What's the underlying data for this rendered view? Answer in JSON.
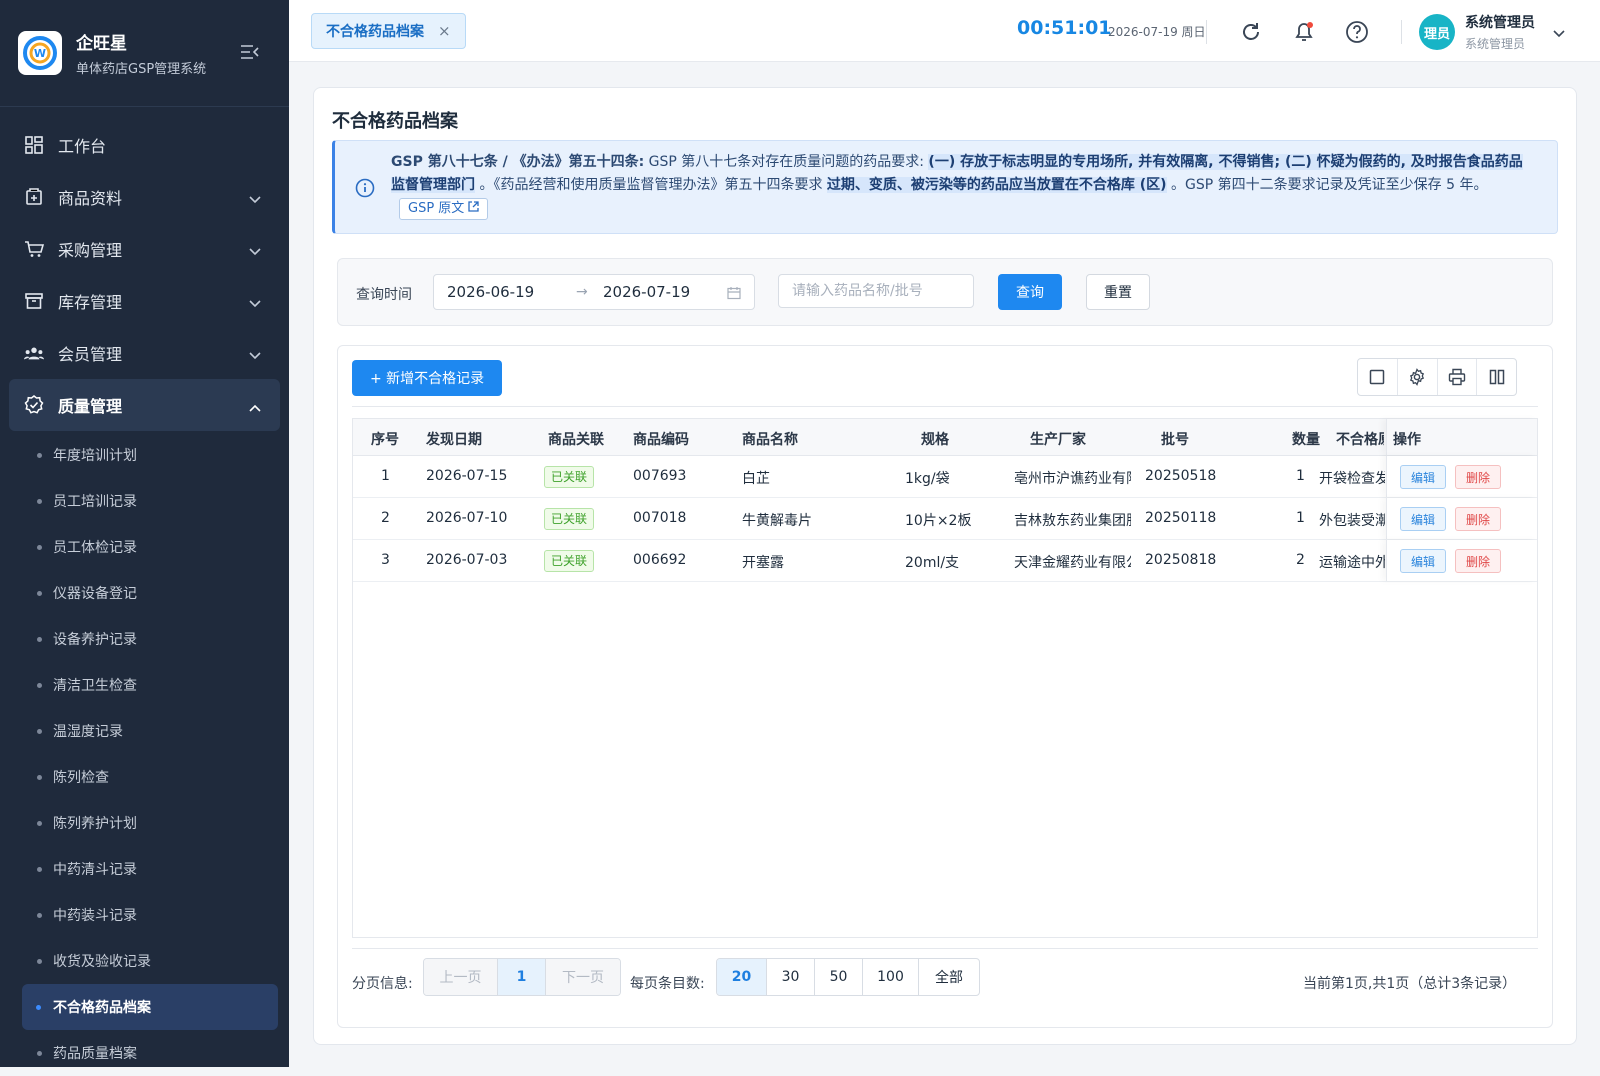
{
  "brand": {
    "name": "企旺星",
    "subtitle": "单体药店GSP管理系统"
  },
  "nav": [
    {
      "label": "工作台",
      "icon": "dashboard-icon",
      "expandable": false
    },
    {
      "label": "商品资料",
      "icon": "product-icon",
      "expandable": true
    },
    {
      "label": "采购管理",
      "icon": "cart-icon",
      "expandable": true
    },
    {
      "label": "库存管理",
      "icon": "inventory-icon",
      "expandable": true
    },
    {
      "label": "会员管理",
      "icon": "members-icon",
      "expandable": true
    },
    {
      "label": "质量管理",
      "icon": "quality-icon",
      "expandable": true,
      "expanded": true
    }
  ],
  "quality_submenu": [
    "年度培训计划",
    "员工培训记录",
    "员工体检记录",
    "仪器设备登记",
    "设备养护记录",
    "清洁卫生检查",
    "温湿度记录",
    "陈列检查",
    "陈列养护计划",
    "中药清斗记录",
    "中药装斗记录",
    "收货及验收记录",
    "不合格药品档案",
    "药品质量档案"
  ],
  "active_submenu": "不合格药品档案",
  "topbar": {
    "tab_label": "不合格药品档案",
    "tab_close": "×",
    "time": "00:51:01",
    "date": "2026-07-19 周日",
    "user_avatar": "理员",
    "user_name": "系统管理员",
    "user_role": "系统管理员",
    "icons": [
      "refresh-icon",
      "bell-icon",
      "help-icon"
    ],
    "has_notification": true
  },
  "page": {
    "title": "不合格药品档案",
    "notice": {
      "lead": "GSP 第八十七条 / 《办法》第五十四条:",
      "t1": " GSP 第八十七条对存在质量问题的药品要求: ",
      "h1": "(一) 存放于标志明显的专用场所, 并有效隔离, 不得销售; (二) 怀疑为假药的, 及时报告食品药品监督管理部门",
      "t2": " 。《药品经营和使用质量监督管理办法》第五十四条要求 ",
      "h2": "过期、变质、被污染等的药品应当放置在不合格库 (区)",
      "t3": " 。GSP 第四十二条要求记录及凭证至少保存 5 年。",
      "link": "GSP 原文"
    },
    "filter": {
      "label": "查询时间",
      "start": "2026-06-19",
      "end": "2026-07-19",
      "arrow": "→",
      "search_placeholder": "请输入药品名称/批号",
      "query": "查询",
      "reset": "重置"
    },
    "add_button": "+ 新增不合格记录",
    "toolbar_icons": [
      "fullscreen-icon",
      "settings-icon",
      "print-icon",
      "columns-icon"
    ],
    "table": {
      "headers": [
        "序号",
        "发现日期",
        "商品关联",
        "商品编码",
        "商品名称",
        "规格",
        "生产厂家",
        "批号",
        "数量",
        "不合格原因",
        "操作"
      ],
      "rows": [
        {
          "no": "1",
          "date": "2026-07-15",
          "linked": "已关联",
          "code": "007693",
          "name": "白芷",
          "spec": "1kg/袋",
          "maker": "亳州市沪谯药业有限公司",
          "batch": "20250518",
          "qty": "1",
          "reason": "开袋检查发现霉变",
          "edit": "编辑",
          "del": "删除"
        },
        {
          "no": "2",
          "date": "2026-07-10",
          "linked": "已关联",
          "code": "007018",
          "name": "牛黄解毒片",
          "spec": "10片×2板",
          "maker": "吉林敖东药业集团股份有限公司",
          "batch": "20250118",
          "qty": "1",
          "reason": "外包装受潮",
          "edit": "编辑",
          "del": "删除"
        },
        {
          "no": "3",
          "date": "2026-07-03",
          "linked": "已关联",
          "code": "006692",
          "name": "开塞露",
          "spec": "20ml/支",
          "maker": "天津金耀药业有限公司",
          "batch": "20250818",
          "qty": "2",
          "reason": "运输途中外包装破损",
          "edit": "编辑",
          "del": "删除"
        }
      ]
    },
    "pager": {
      "label": "分页信息:",
      "prev": "上一页",
      "current": "1",
      "next": "下一页",
      "size_label": "每页条目数:",
      "sizes": [
        "20",
        "30",
        "50",
        "100",
        "全部"
      ],
      "selected_size": "20",
      "status": "当前第1页,共1页（总计3条记录）"
    }
  }
}
